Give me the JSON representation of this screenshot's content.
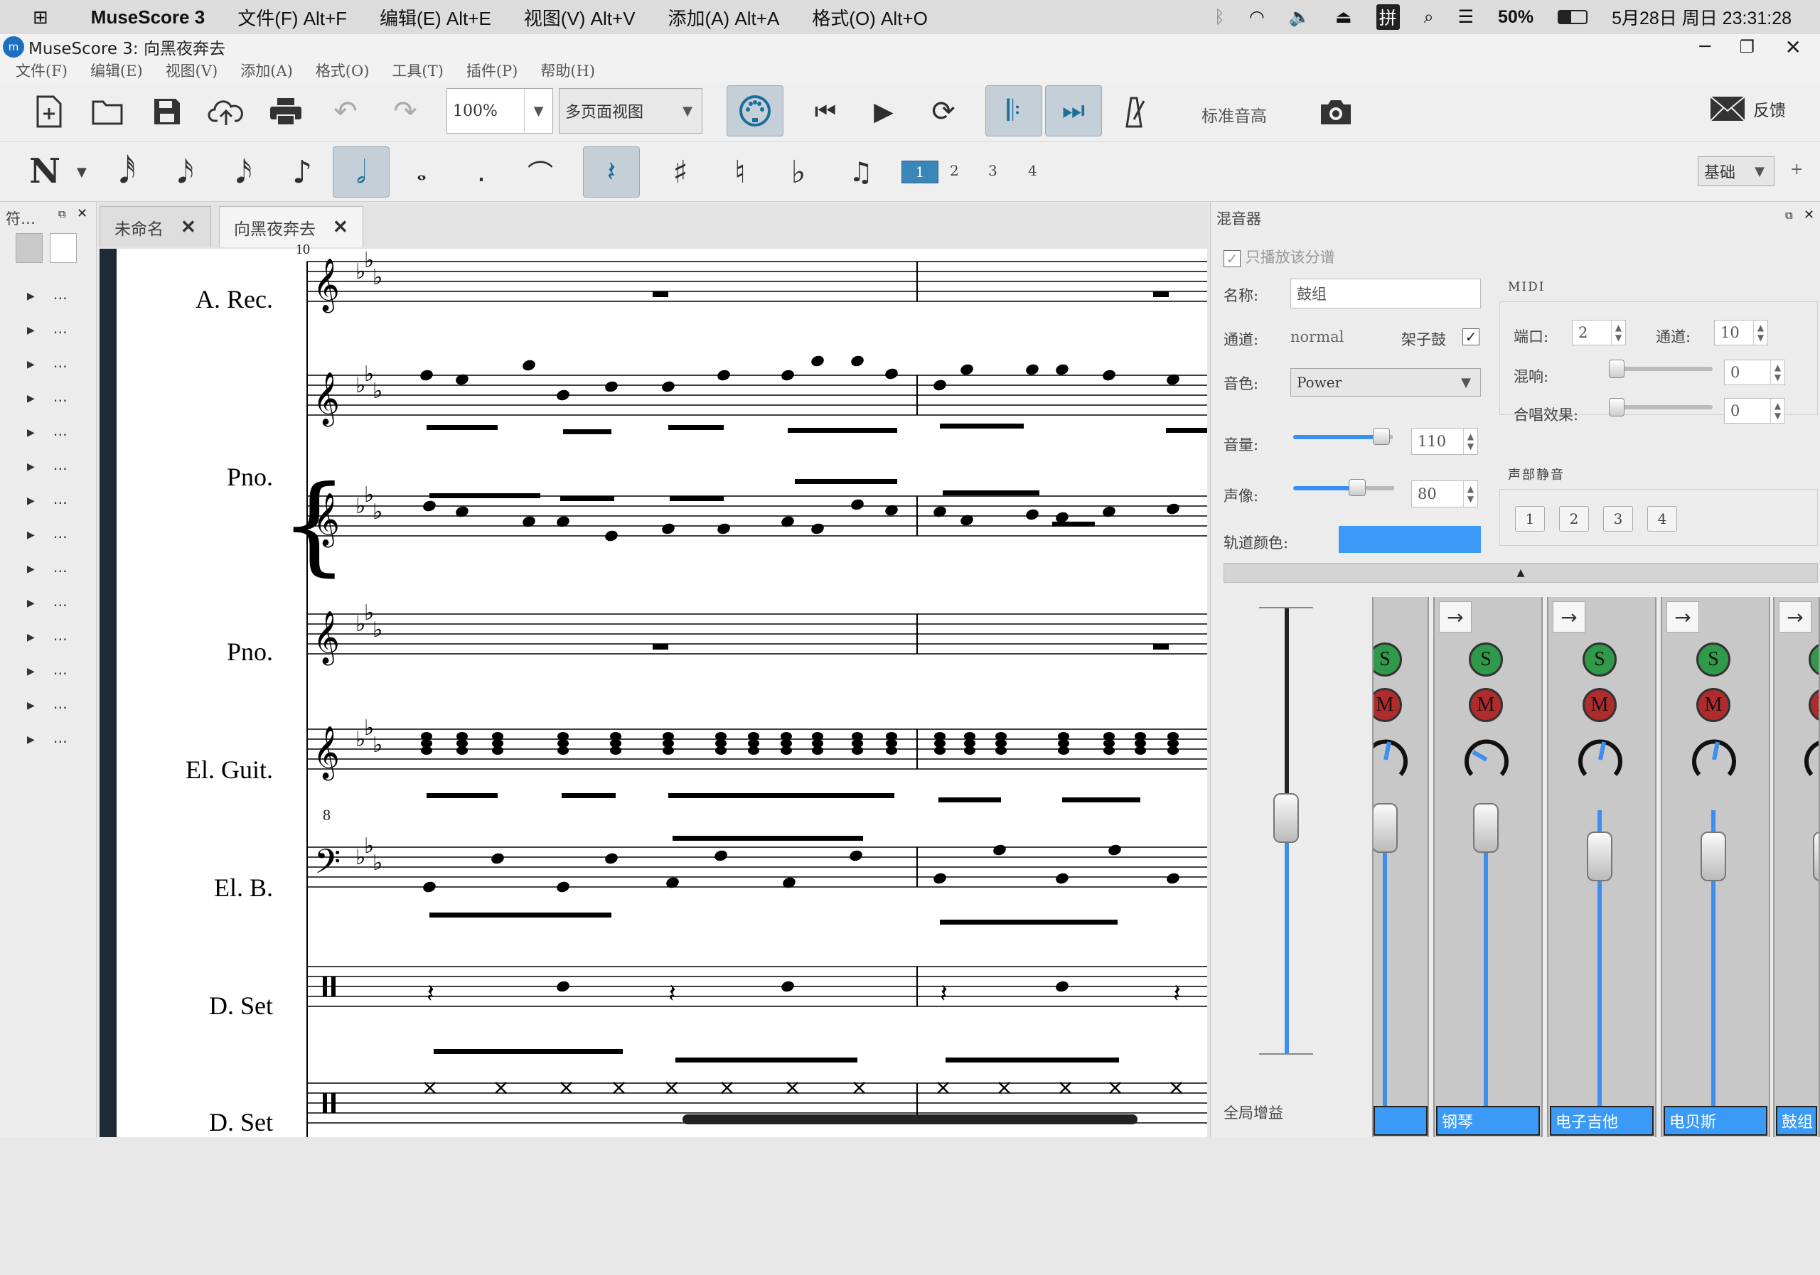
{
  "macbar": {
    "app": "MuseScore 3",
    "menus": [
      "文件(F) Alt+F",
      "编辑(E) Alt+E",
      "视图(V) Alt+V",
      "添加(A) Alt+A",
      "格式(O) Alt+O"
    ],
    "battery": "50%",
    "clock": "5月28日 周日 23:31:28",
    "ime": "拼"
  },
  "window": {
    "title": "MuseScore 3: 向黑夜奔去",
    "menus": [
      "文件(F)",
      "编辑(E)",
      "视图(V)",
      "添加(A)",
      "格式(O)",
      "工具(T)",
      "插件(P)",
      "帮助(H)"
    ]
  },
  "toolbar": {
    "zoom": "100%",
    "view_mode": "多页面视图",
    "concert_pitch": "标准音高",
    "feedback": "反馈"
  },
  "note_toolbar": {
    "voices": [
      "1",
      "2",
      "3",
      "4"
    ],
    "workspace": "基础",
    "plus": "+"
  },
  "palette": {
    "title": "符…",
    "items": [
      "…",
      "…",
      "…",
      "…",
      "…",
      "…",
      "…",
      "…",
      "…",
      "…",
      "…",
      "…",
      "…",
      "…"
    ]
  },
  "tabs": [
    {
      "label": "未命名",
      "close": "✕"
    },
    {
      "label": "向黑夜奔去",
      "close": "✕"
    }
  ],
  "score": {
    "measure_number": "10",
    "instruments": [
      "A. Rec.",
      "Pno.",
      "Pno.",
      "El. Guit.",
      "El. B.",
      "D. Set",
      "D. Set"
    ],
    "guitar_octave": "8"
  },
  "mixer": {
    "title": "混音器",
    "solo_only": "只播放该分谱",
    "name_label": "名称:",
    "name_value": "鼓组",
    "channel_label": "通道:",
    "channel_value": "normal",
    "drumset_label": "架子鼓",
    "sound_label": "音色:",
    "sound_value": "Power",
    "volume_label": "音量:",
    "volume_value": "110",
    "pan_label": "声像:",
    "pan_value": "80",
    "color_label": "轨道颜色:",
    "track_color": "#3b9af5",
    "midi_title": "MIDI",
    "port_label": "端口:",
    "port_value": "2",
    "midi_channel_label": "通道:",
    "midi_channel_value": "10",
    "reverb_label": "混响:",
    "reverb_value": "0",
    "chorus_label": "合唱效果:",
    "chorus_value": "0",
    "voice_mute_title": "声部静音",
    "voice_buttons": [
      "1",
      "2",
      "3",
      "4"
    ],
    "master_gain": "全局增益",
    "strips": [
      {
        "name": "",
        "solo": "S",
        "mute": "M",
        "arrow": "→"
      },
      {
        "name": "钢琴",
        "solo": "S",
        "mute": "M",
        "arrow": "→"
      },
      {
        "name": "电子吉他",
        "solo": "S",
        "mute": "M",
        "arrow": "→"
      },
      {
        "name": "电贝斯",
        "solo": "S",
        "mute": "M",
        "arrow": "→"
      },
      {
        "name": "鼓组",
        "solo": "S",
        "mute": "M",
        "arrow": "→"
      }
    ]
  }
}
